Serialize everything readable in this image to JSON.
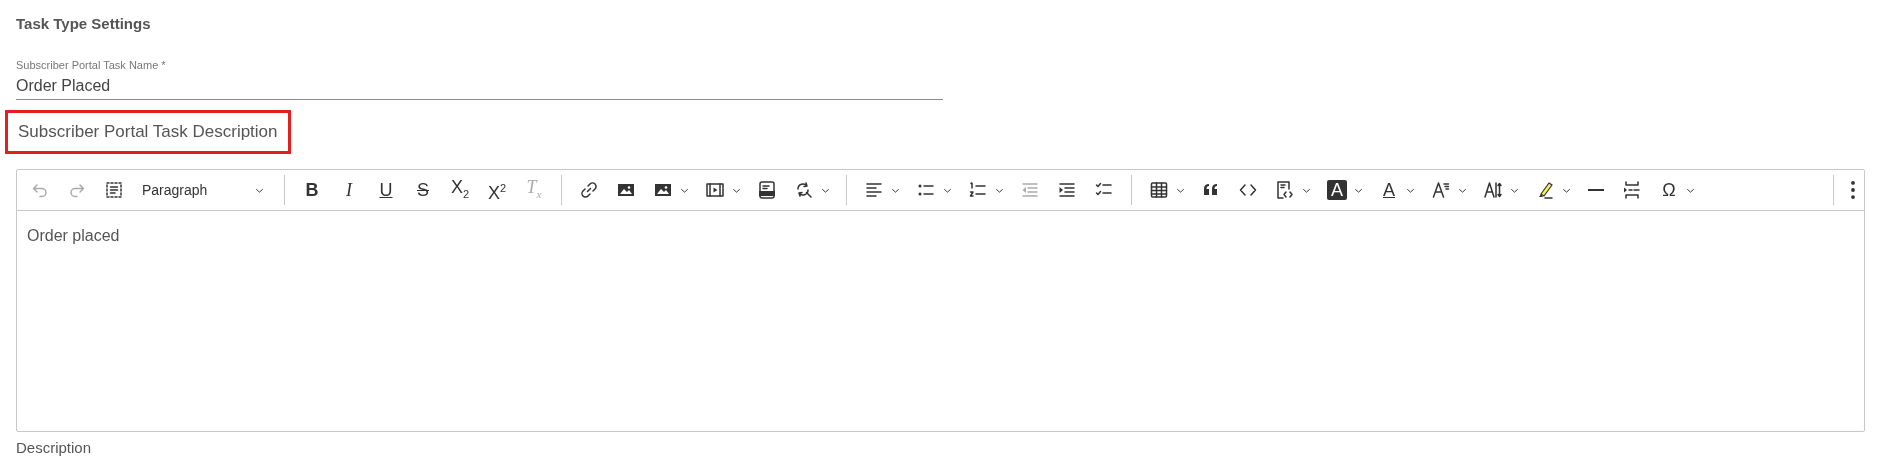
{
  "section_title": "Task Type Settings",
  "name_field": {
    "label": "Subscriber Portal Task Name *",
    "value": "Order Placed"
  },
  "description_heading": {
    "text": "Subscriber Portal Task Description",
    "highlighted": true
  },
  "editor": {
    "toolbar": [
      {
        "kind": "button",
        "disabled": true
      },
      {
        "kind": "button",
        "disabled": true
      },
      {
        "kind": "button",
        "disabled": false
      },
      {
        "kind": "select",
        "value": "Paragraph"
      },
      {
        "kind": "separator"
      },
      {
        "kind": "bold",
        "label": "B",
        "disabled": false,
        "dropdown": false
      },
      {
        "kind": "italic",
        "label": "I",
        "disabled": false,
        "dropdown": false
      },
      {
        "kind": "underline",
        "label": "U",
        "disabled": false,
        "dropdown": false
      },
      {
        "kind": "strike",
        "label": "S",
        "disabled": false,
        "dropdown": false
      },
      {
        "kind": "text",
        "label": "X$_{2}$",
        "disabled": false,
        "dropdown": false
      },
      {
        "kind": "text",
        "label": "X$^{2}$",
        "disabled": false,
        "dropdown": false
      },
      {
        "kind": "italic",
        "label": "T$_{x}$",
        "disabled": true,
        "dropdown": false
      },
      {
        "kind": "separator"
      },
      {
        "kind": "button",
        "disabled": false
      },
      {
        "kind": "button",
        "disabled": false
      },
      {
        "kind": "split",
        "disabled": false
      },
      {
        "kind": "split",
        "disabled": false
      },
      {
        "kind": "button",
        "disabled": false
      },
      {
        "kind": "split",
        "disabled": false
      },
      {
        "kind": "separator"
      },
      {
        "kind": "split",
        "disabled": false
      },
      {
        "kind": "split",
        "disabled": false
      },
      {
        "kind": "split",
        "disabled": false
      },
      {
        "kind": "button",
        "disabled": true
      },
      {
        "kind": "button",
        "disabled": false
      },
      {
        "kind": "button",
        "disabled": false
      },
      {
        "kind": "separator"
      },
      {
        "kind": "split",
        "disabled": false
      },
      {
        "kind": "button",
        "disabled": false
      },
      {
        "kind": "button",
        "disabled": false
      },
      {
        "kind": "split",
        "disabled": false
      },
      {
        "kind": "inverse",
        "label": "A",
        "disabled": false,
        "dropdown": true
      },
      {
        "kind": "underline",
        "label": "A",
        "disabled": false,
        "dropdown": true
      },
      {
        "kind": "split",
        "disabled": false
      },
      {
        "kind": "split",
        "disabled": false
      },
      {
        "kind": "split",
        "disabled": false
      },
      {
        "kind": "button",
        "disabled": false
      },
      {
        "kind": "button",
        "disabled": false
      },
      {
        "kind": "text",
        "label": "Ω",
        "disabled": false,
        "dropdown": true
      },
      {
        "kind": "more"
      }
    ],
    "content": "Order placed"
  },
  "next_field_label": "Description"
}
